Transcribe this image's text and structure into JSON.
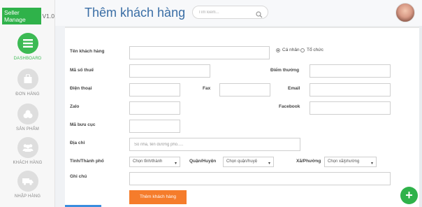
{
  "brand": {
    "name": "Seller Manage",
    "version": "V1.0"
  },
  "sidebar": {
    "items": [
      {
        "label": "DASHBOARD",
        "icon": "list-icon",
        "active": true
      },
      {
        "label": "ĐƠN HÀNG",
        "icon": "bag-icon",
        "active": false
      },
      {
        "label": "SẢN PHẨM",
        "icon": "boxes-icon",
        "active": false
      },
      {
        "label": "KHÁCH HÀNG",
        "icon": "users-icon",
        "active": false
      },
      {
        "label": "NHẬP HÀNG",
        "icon": "truck-icon",
        "active": false
      }
    ]
  },
  "header": {
    "title": "Thêm khách hàng",
    "search_placeholder": "Tìm kiếm..."
  },
  "form": {
    "name_label": "Tên khách hàng",
    "radio_personal": "Cá nhân",
    "radio_org": "Tổ chức",
    "tax_label": "Mã số thuế",
    "points_label": "Điểm thưởng",
    "phone_label": "Điện thoại",
    "fax_label": "Fax",
    "email_label": "Email",
    "zalo_label": "Zalo",
    "facebook_label": "Facebook",
    "postal_label": "Mã bưu cục",
    "address_label": "Địa chỉ",
    "address_placeholder": "Số nhà, tên đường phố.....",
    "city_label": "Tỉnh/Thành phố",
    "city_value": "Chọn tỉnh/thành",
    "district_label": "Quận/Huyện",
    "district_value": "Chọn quận/huyệ",
    "ward_label": "Xã/Phường",
    "ward_value": "Chọn xã/phường",
    "note_label": "Ghi chú",
    "submit_label": "Thêm khách hàng"
  },
  "fab": {
    "label": "+"
  },
  "colors": {
    "accent_green": "#2fb24a",
    "title_blue": "#3a6ea5",
    "submit_orange": "#f57c2b"
  }
}
